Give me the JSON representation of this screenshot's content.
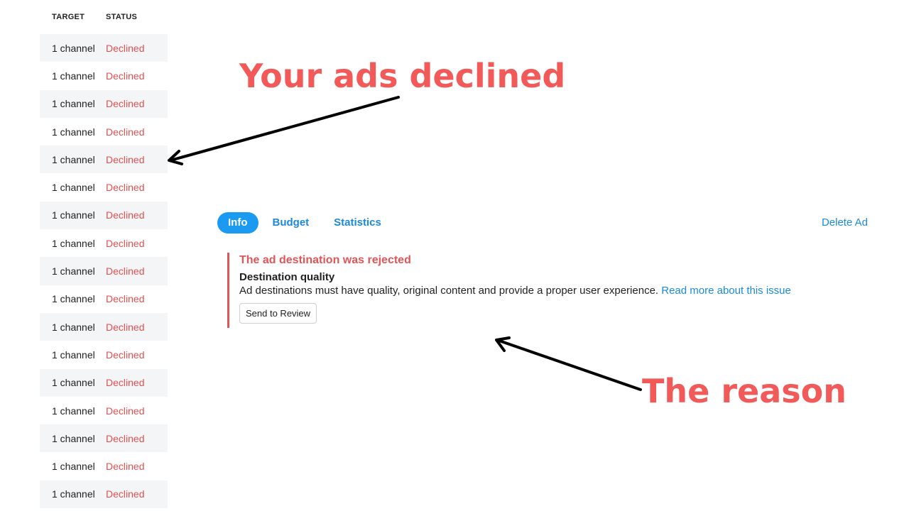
{
  "table": {
    "headers": {
      "target": "TARGET",
      "status": "STATUS"
    },
    "rows": [
      {
        "target": "1 channel",
        "status": "Declined"
      },
      {
        "target": "1 channel",
        "status": "Declined"
      },
      {
        "target": "1 channel",
        "status": "Declined"
      },
      {
        "target": "1 channel",
        "status": "Declined"
      },
      {
        "target": "1 channel",
        "status": "Declined"
      },
      {
        "target": "1 channel",
        "status": "Declined"
      },
      {
        "target": "1 channel",
        "status": "Declined"
      },
      {
        "target": "1 channel",
        "status": "Declined"
      },
      {
        "target": "1 channel",
        "status": "Declined"
      },
      {
        "target": "1 channel",
        "status": "Declined"
      },
      {
        "target": "1 channel",
        "status": "Declined"
      },
      {
        "target": "1 channel",
        "status": "Declined"
      },
      {
        "target": "1 channel",
        "status": "Declined"
      },
      {
        "target": "1 channel",
        "status": "Declined"
      },
      {
        "target": "1 channel",
        "status": "Declined"
      },
      {
        "target": "1 channel",
        "status": "Declined"
      },
      {
        "target": "1 channel",
        "status": "Declined"
      }
    ]
  },
  "tabs": [
    {
      "label": "Info",
      "active": true
    },
    {
      "label": "Budget",
      "active": false
    },
    {
      "label": "Statistics",
      "active": false
    }
  ],
  "delete_ad_label": "Delete Ad",
  "issue": {
    "title": "The ad destination was rejected",
    "subtitle": "Destination quality",
    "description": "Ad destinations must have quality, original content and provide a proper user experience.",
    "link_text": "Read more about this issue",
    "button_label": "Send to Review"
  },
  "annotations": {
    "top": "Your ads declined",
    "bottom": "The reason"
  },
  "colors": {
    "declined": "#e05050",
    "accent_blue": "#1a9af0",
    "link_blue": "#1d89d6",
    "issue_red": "#e05558",
    "annotation_red": "#f25a5a",
    "row_alt": "#f4f5f7"
  }
}
